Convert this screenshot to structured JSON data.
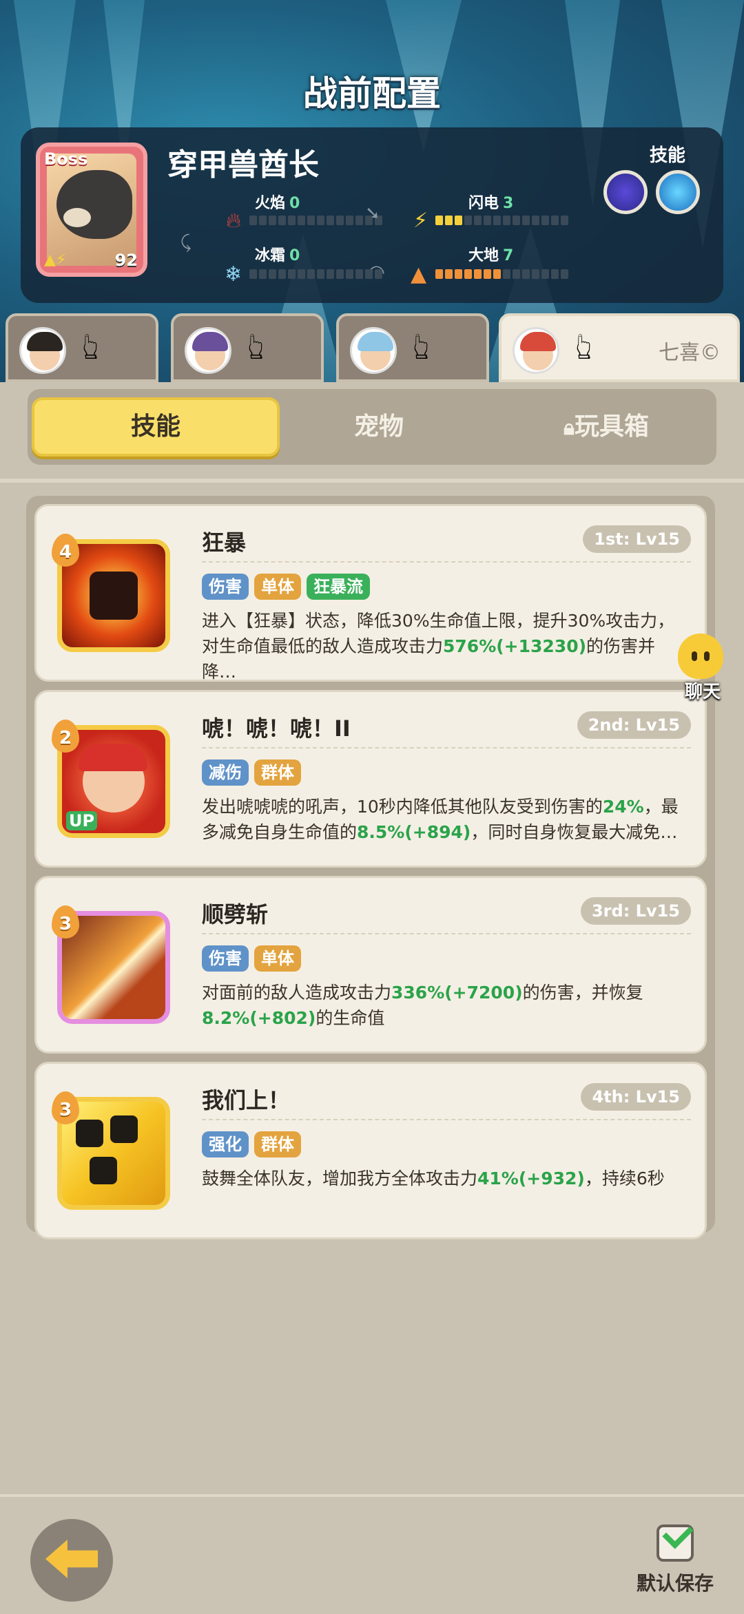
{
  "page_title": "战前配置",
  "boss": {
    "badge": "Boss",
    "name": "穿甲兽酋长",
    "level": "92",
    "skill_label": "技能",
    "stats": {
      "fire": {
        "label": "火焰",
        "value": "0"
      },
      "lightning": {
        "label": "闪电",
        "value": "3"
      },
      "frost": {
        "label": "冰霜",
        "value": "0"
      },
      "earth": {
        "label": "大地",
        "value": "7"
      }
    }
  },
  "hero_tabs": [
    {
      "id": "hero-1"
    },
    {
      "id": "hero-2"
    },
    {
      "id": "hero-3"
    },
    {
      "id": "hero-4",
      "name": "七喜©"
    }
  ],
  "segments": {
    "skills": "技能",
    "pets": "宠物",
    "toybox": "玩具箱"
  },
  "skills": [
    {
      "rank": "4",
      "name": "狂暴",
      "level": "1st: Lv15",
      "tags": [
        "伤害",
        "单体",
        "狂暴流"
      ],
      "desc_a": "进入【狂暴】状态，降低30%生命值上限，提升30%攻击力，对生命值最低的敌人造成攻击力",
      "desc_b": "576%(+13230)",
      "desc_c": "的伤害并降…"
    },
    {
      "rank": "2",
      "name": "唬！唬！唬！II",
      "level": "2nd: Lv15",
      "tags": [
        "减伤",
        "群体"
      ],
      "up_badge": "UP",
      "desc_a": "发出唬唬唬的吼声，10秒内降低其他队友受到伤害的",
      "desc_b": "24%",
      "desc_c": "，最多减免自身生命值的",
      "desc_d": "8.5%(+894)",
      "desc_e": "，同时自身恢复最大减免…"
    },
    {
      "rank": "3",
      "name": "顺劈斩",
      "level": "3rd: Lv15",
      "tags": [
        "伤害",
        "单体"
      ],
      "desc_a": "对面前的敌人造成攻击力",
      "desc_b": "336%(+7200)",
      "desc_c": "的伤害，并恢复",
      "desc_d": "8.2%(+802)",
      "desc_e": "的生命值"
    },
    {
      "rank": "3",
      "name": "我们上！",
      "level": "4th: Lv15",
      "tags": [
        "强化",
        "群体"
      ],
      "desc_a": "鼓舞全体队友，增加我方全体攻击力",
      "desc_b": "41%(+932)",
      "desc_c": "，持续6秒"
    }
  ],
  "chat": {
    "label": "聊天"
  },
  "footer": {
    "save_label": "默认保存"
  },
  "colors": {
    "accent_yellow": "#f9df6a",
    "value_green": "#2aa34a",
    "boss_card": "#e8747a"
  }
}
